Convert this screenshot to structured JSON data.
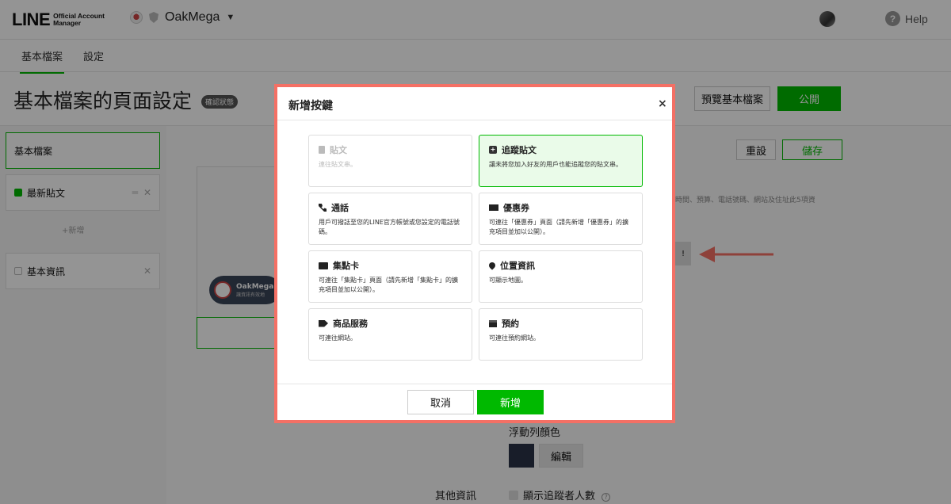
{
  "header": {
    "logo_main": "LINE",
    "logo_sub_1": "Official Account",
    "logo_sub_2": "Manager",
    "account_name": "OakMega",
    "help_label": "Help"
  },
  "tabs": [
    {
      "label": "基本檔案",
      "active": true
    },
    {
      "label": "設定",
      "active": false
    }
  ],
  "page": {
    "title": "基本檔案的頁面設定",
    "status_badge": "確認狀態",
    "preview_button": "預覽基本檔案",
    "publish_button": "公開",
    "reset_button": "重設",
    "save_button": "儲存"
  },
  "sidebar": {
    "items": [
      {
        "label": "基本檔案",
        "checkbox": null
      },
      {
        "label": "最新貼文",
        "checkbox": "checked"
      },
      {
        "label": "基本資訊",
        "checkbox": "unchecked"
      }
    ],
    "add_label": "+新增"
  },
  "preview": {
    "account_name": "OakMega",
    "sub_text": "讓資訊有效地"
  },
  "right_panel": {
    "hint_text": "時間、預算、電話號碼、網站及住址此5項資",
    "chip_text": "!",
    "float_bar_label": "浮動列顏色",
    "float_bar_color": "#2a3247",
    "edit_button": "編輯",
    "other_info_label": "其他資訊",
    "follower_count_label": "顯示追蹤者人數",
    "help_glyph": "?"
  },
  "modal": {
    "title": "新增按鍵",
    "close_glyph": "×",
    "options": [
      {
        "title": "貼文",
        "desc": "連往貼文串。",
        "icon": "post-icon",
        "state": "disabled"
      },
      {
        "title": "追蹤貼文",
        "desc": "讓未將您加入好友的用戶也能追蹤您的貼文串。",
        "icon": "plus-square-icon",
        "state": "selected"
      },
      {
        "title": "通話",
        "desc": "用戶可撥話至您的LINE官方帳號或您設定的電話號碼。",
        "icon": "phone-icon",
        "state": "normal"
      },
      {
        "title": "優惠券",
        "desc": "可連往「優惠券」頁面（請先新增「優惠券」的擴充項目並加以公開）。",
        "icon": "coupon-icon",
        "state": "normal"
      },
      {
        "title": "集點卡",
        "desc": "可連往「集點卡」頁面（請先新增「集點卡」的擴充項目並加以公開）。",
        "icon": "card-icon",
        "state": "normal"
      },
      {
        "title": "位置資訊",
        "desc": "可顯示地圖。",
        "icon": "location-pin-icon",
        "state": "normal"
      },
      {
        "title": "商品服務",
        "desc": "可連往網站。",
        "icon": "tag-icon",
        "state": "normal"
      },
      {
        "title": "預約",
        "desc": "可連往預約網站。",
        "icon": "calendar-icon",
        "state": "normal"
      }
    ],
    "cancel_button": "取消",
    "add_button": "新增"
  },
  "colors": {
    "brand_green": "#00b900",
    "highlight_red": "#f47065"
  }
}
